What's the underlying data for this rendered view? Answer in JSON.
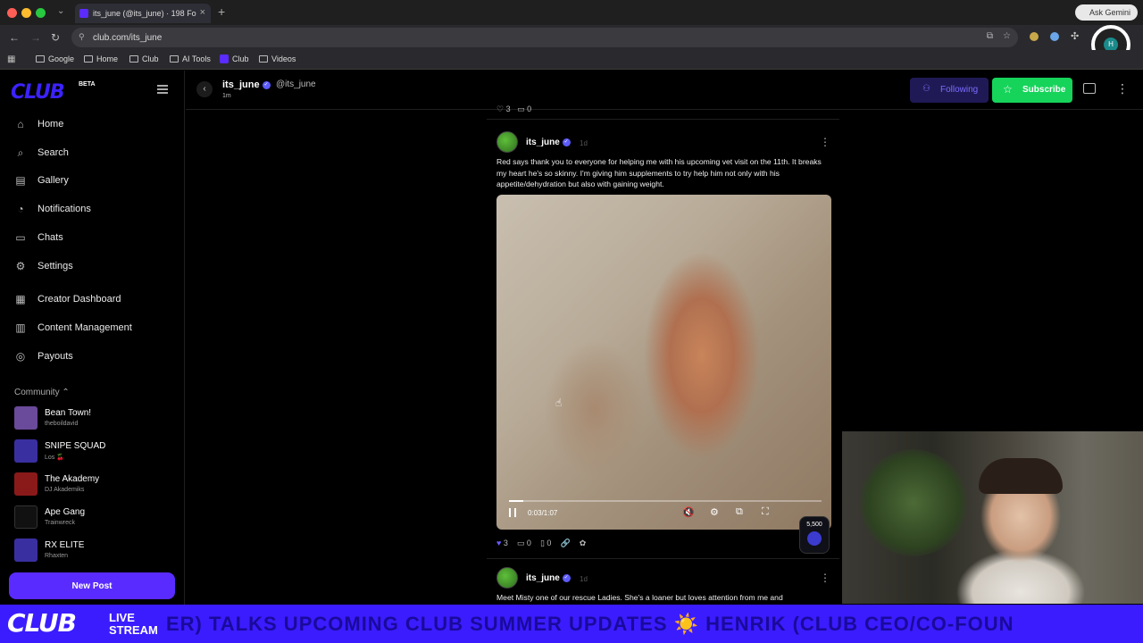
{
  "browser": {
    "tab_title": "its_june (@its_june) · 198 Fo",
    "url": "club.com/its_june",
    "gemini_label": "Ask Gemini",
    "profile_initial": "H",
    "bookmarks": [
      "Google",
      "Home",
      "Club",
      "AI Tools",
      "Club",
      "Videos"
    ]
  },
  "app": {
    "logo": "CLUB",
    "beta": "BETA"
  },
  "sidebar": {
    "nav": [
      {
        "label": "Home",
        "icon": "home-icon",
        "glyph": "⌂"
      },
      {
        "label": "Search",
        "icon": "search-icon",
        "glyph": "⌕"
      },
      {
        "label": "Gallery",
        "icon": "gallery-icon",
        "glyph": "▤"
      },
      {
        "label": "Notifications",
        "icon": "bell-icon",
        "glyph": "◔"
      },
      {
        "label": "Chats",
        "icon": "chat-icon",
        "glyph": "▭"
      },
      {
        "label": "Settings",
        "icon": "gear-icon",
        "glyph": "⚙"
      },
      {
        "label": "Creator Dashboard",
        "icon": "dashboard-icon",
        "glyph": "▦"
      },
      {
        "label": "Content Management",
        "icon": "content-icon",
        "glyph": "▥"
      },
      {
        "label": "Payouts",
        "icon": "payouts-icon",
        "glyph": "◎"
      }
    ],
    "community_label": "Community",
    "communities": [
      {
        "name": "Bean Town!",
        "sub": "theboildavid",
        "color": "#6a4a9a"
      },
      {
        "name": "SNIPE SQUAD",
        "sub": "Los 🍒",
        "color": "#3a2fa0"
      },
      {
        "name": "The Akademy",
        "sub": "DJ Akademiks",
        "color": "#8a1a1a"
      },
      {
        "name": "Ape Gang",
        "sub": "Trainwreck",
        "color": "#111111"
      },
      {
        "name": "RX ELITE",
        "sub": "Rhaxten",
        "color": "#3a2fa0"
      }
    ],
    "new_post": "New Post"
  },
  "header": {
    "name": "its_june",
    "handle": "@its_june",
    "last_seen": "1m",
    "following": "Following",
    "subscribe": "Subscribe"
  },
  "prev_post": {
    "likes": "3",
    "comments": "0"
  },
  "post": {
    "author": "its_june",
    "time": "1d",
    "text": "Red says thank you to everyone for helping me with his upcoming vet visit on the 11th. It breaks my heart he's so skinny. I'm giving him supplements to try help him not only with his appetite/dehydration but also with gaining weight.",
    "video_time": "0:03/1:07",
    "video_progress": 0.045,
    "likes": "3",
    "comments": "0",
    "saves": "0",
    "badge_value": "5,500"
  },
  "next_post": {
    "author": "its_june",
    "time": "1d",
    "text": "Meet Misty one of our rescue Ladies. She's a loaner but loves attention from me and"
  },
  "ticker": {
    "logo": "CLUB",
    "live": "LIVE",
    "stream": "STREAM",
    "text": "ER) TALKS UPCOMING CLUB SUMMER UPDATES ☀️ HENRIK (CLUB CEO/CO-FOUN"
  }
}
